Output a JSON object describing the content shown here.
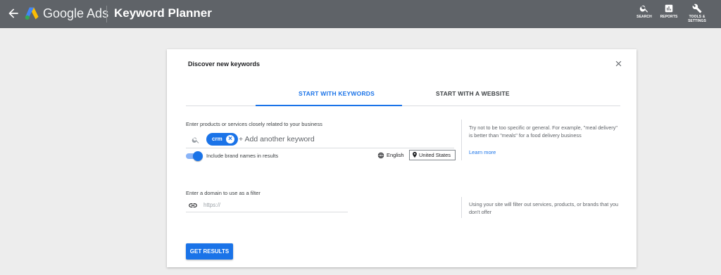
{
  "header": {
    "app_name": "Google Ads",
    "page_title": "Keyword Planner",
    "tools": [
      {
        "label": "SEARCH",
        "icon": "search-icon"
      },
      {
        "label": "REPORTS",
        "icon": "reports-icon"
      },
      {
        "label": "TOOLS &",
        "label2": "SETTINGS",
        "icon": "wrench-icon"
      }
    ],
    "colors": {
      "bar": "#5f6368",
      "accent": "#1a73e8"
    }
  },
  "dialog": {
    "title": "Discover new keywords",
    "tabs": [
      {
        "label": "START WITH KEYWORDS",
        "active": true
      },
      {
        "label": "START WITH A WEBSITE",
        "active": false
      }
    ],
    "keywords_label": "Enter products or services closely related to your business",
    "chips": [
      "crm"
    ],
    "add_keyword_placeholder": "+ Add another keyword",
    "brand_toggle_label": "Include brand names in results",
    "brand_toggle_on": true,
    "language": "English",
    "location": "United States",
    "keywords_hint": "Try not to be too specific or general. For example, \"meal delivery\" is better than \"meals\" for a food delivery business",
    "learn_more": "Learn more",
    "domain_label": "Enter a domain to use as a filter",
    "domain_placeholder": "https://",
    "domain_hint": "Using your site will filter out services, products, or brands that you don't offer",
    "submit_label": "GET RESULTS"
  }
}
